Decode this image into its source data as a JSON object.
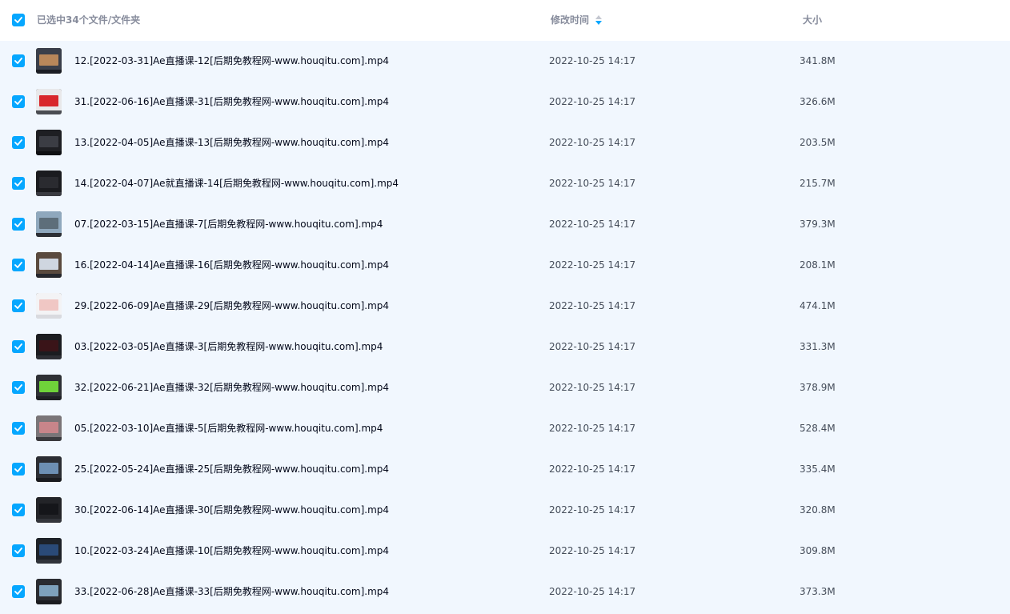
{
  "header": {
    "selection_text": "已选中34个文件/文件夹",
    "col_modified": "修改时间",
    "col_size": "大小"
  },
  "colors": {
    "accent": "#06a7ff",
    "row_background": "#f1f7fe",
    "header_text": "#878c9c"
  },
  "files": [
    {
      "name": "12.[2022-03-31]Ae直播课-12[后期免教程网-www.houqitu.com].mp4",
      "modified": "2022-10-25 14:17",
      "size": "341.8M",
      "thumb": {
        "bg": "#3a3f4a",
        "fg": "#b8875a",
        "bar": "#1c1e24"
      },
      "icon": "video-thumbnail-icon"
    },
    {
      "name": "31.[2022-06-16]Ae直播课-31[后期免教程网-www.houqitu.com].mp4",
      "modified": "2022-10-25 14:17",
      "size": "326.6M",
      "thumb": {
        "bg": "#e8e8ea",
        "fg": "#d8262b",
        "bar": "#4a4c52"
      },
      "icon": "video-thumbnail-icon"
    },
    {
      "name": "13.[2022-04-05]Ae直播课-13[后期免教程网-www.houqitu.com].mp4",
      "modified": "2022-10-25 14:17",
      "size": "203.5M",
      "thumb": {
        "bg": "#1e1f23",
        "fg": "#3b3d44",
        "bar": "#0f1013"
      },
      "icon": "video-thumbnail-icon"
    },
    {
      "name": "14.[2022-04-07]Ae就直播课-14[后期免教程网-www.houqitu.com].mp4",
      "modified": "2022-10-25 14:17",
      "size": "215.7M",
      "thumb": {
        "bg": "#1a1b1f",
        "fg": "#2a2b30",
        "bar": "#3a3b41"
      },
      "icon": "video-thumbnail-icon"
    },
    {
      "name": "07.[2022-03-15]Ae直播课-7[后期免教程网-www.houqitu.com].mp4",
      "modified": "2022-10-25 14:17",
      "size": "379.3M",
      "thumb": {
        "bg": "#8fa8bd",
        "fg": "#5d6e7a",
        "bar": "#2c2f35"
      },
      "icon": "video-thumbnail-icon"
    },
    {
      "name": "16.[2022-04-14]Ae直播课-16[后期免教程网-www.houqitu.com].mp4",
      "modified": "2022-10-25 14:17",
      "size": "208.1M",
      "thumb": {
        "bg": "#5a4a3e",
        "fg": "#cfd6e0",
        "bar": "#26272c"
      },
      "icon": "video-thumbnail-icon"
    },
    {
      "name": "29.[2022-06-09]Ae直播课-29[后期免教程网-www.houqitu.com].mp4",
      "modified": "2022-10-25 14:17",
      "size": "474.1M",
      "thumb": {
        "bg": "#f3f3f5",
        "fg": "#f0c7c4",
        "bar": "#d9dadf"
      },
      "icon": "video-thumbnail-icon"
    },
    {
      "name": "03.[2022-03-05]Ae直播课-3[后期免教程网-www.houqitu.com].mp4",
      "modified": "2022-10-25 14:17",
      "size": "331.3M",
      "thumb": {
        "bg": "#1b1c20",
        "fg": "#3a1418",
        "bar": "#2d2e34"
      },
      "icon": "video-thumbnail-icon"
    },
    {
      "name": "32.[2022-06-21]Ae直播课-32[后期免教程网-www.houqitu.com].mp4",
      "modified": "2022-10-25 14:17",
      "size": "378.9M",
      "thumb": {
        "bg": "#2e3035",
        "fg": "#6fd23a",
        "bar": "#1f2024"
      },
      "icon": "video-thumbnail-icon"
    },
    {
      "name": "05.[2022-03-10]Ae直播课-5[后期免教程网-www.houqitu.com].mp4",
      "modified": "2022-10-25 14:17",
      "size": "528.4M",
      "thumb": {
        "bg": "#7a7578",
        "fg": "#c8858a",
        "bar": "#3b3a3e"
      },
      "icon": "video-thumbnail-icon"
    },
    {
      "name": "25.[2022-05-24]Ae直播课-25[后期免教程网-www.houqitu.com].mp4",
      "modified": "2022-10-25 14:17",
      "size": "335.4M",
      "thumb": {
        "bg": "#2b2d33",
        "fg": "#6d8fb3",
        "bar": "#1a1b1f"
      },
      "icon": "video-thumbnail-icon"
    },
    {
      "name": "30.[2022-06-14]Ae直播课-30[后期免教程网-www.houqitu.com].mp4",
      "modified": "2022-10-25 14:17",
      "size": "320.8M",
      "thumb": {
        "bg": "#232428",
        "fg": "#15161a",
        "bar": "#33353b"
      },
      "icon": "video-thumbnail-icon"
    },
    {
      "name": "10.[2022-03-24]Ae直播课-10[后期免教程网-www.houqitu.com].mp4",
      "modified": "2022-10-25 14:17",
      "size": "309.8M",
      "thumb": {
        "bg": "#1d2128",
        "fg": "#2a4a78",
        "bar": "#30333a"
      },
      "icon": "video-thumbnail-icon"
    },
    {
      "name": "33.[2022-06-28]Ae直播课-33[后期免教程网-www.houqitu.com].mp4",
      "modified": "2022-10-25 14:17",
      "size": "373.3M",
      "thumb": {
        "bg": "#2a2c31",
        "fg": "#7ea2bd",
        "bar": "#1b1c20"
      },
      "icon": "video-thumbnail-icon"
    }
  ]
}
